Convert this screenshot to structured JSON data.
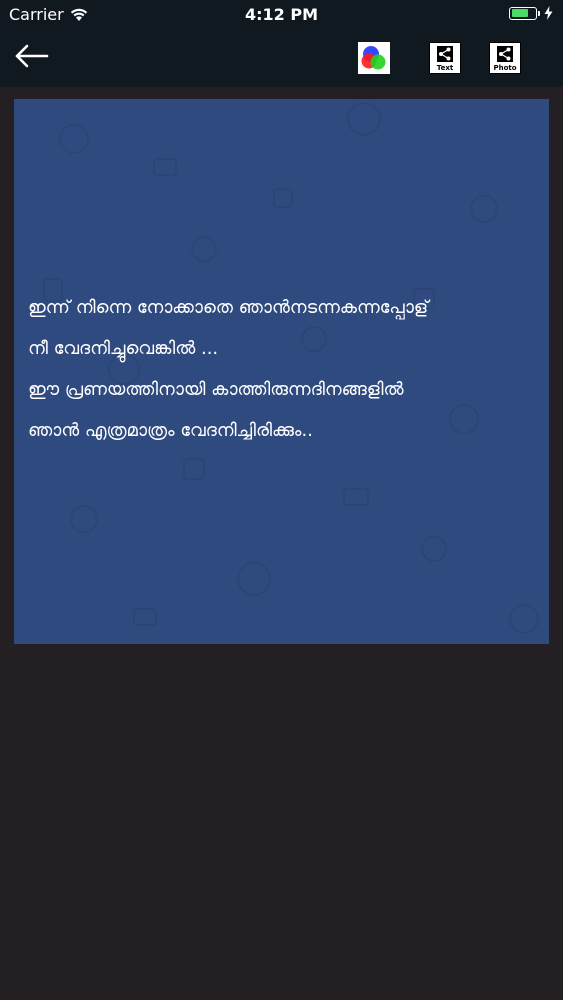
{
  "status_bar": {
    "carrier": "Carrier",
    "time": "4:12 PM",
    "battery_level": 0.75
  },
  "toolbar": {
    "share_text_label": "Text",
    "share_photo_label": "Photo"
  },
  "quote": {
    "lines": [
      "ഇന്ന് നിന്നെ നോക്കാതെ ഞാൻനടന്നകന്നപ്പോള്",
      "നീ വേദനിച്ചുവെങ്കിൽ ...",
      "ഈ പ്രണയത്തിനായി കാത്തിരുന്നദിനങ്ങളിൽ",
      "ഞാൻ എത്രമാത്രം വേദനിച്ചിരിക്കും.."
    ],
    "card_color": "#2f4a7f"
  },
  "colors": {
    "topbar": "#101820",
    "background": "#231f22",
    "battery": "#4cd964"
  }
}
